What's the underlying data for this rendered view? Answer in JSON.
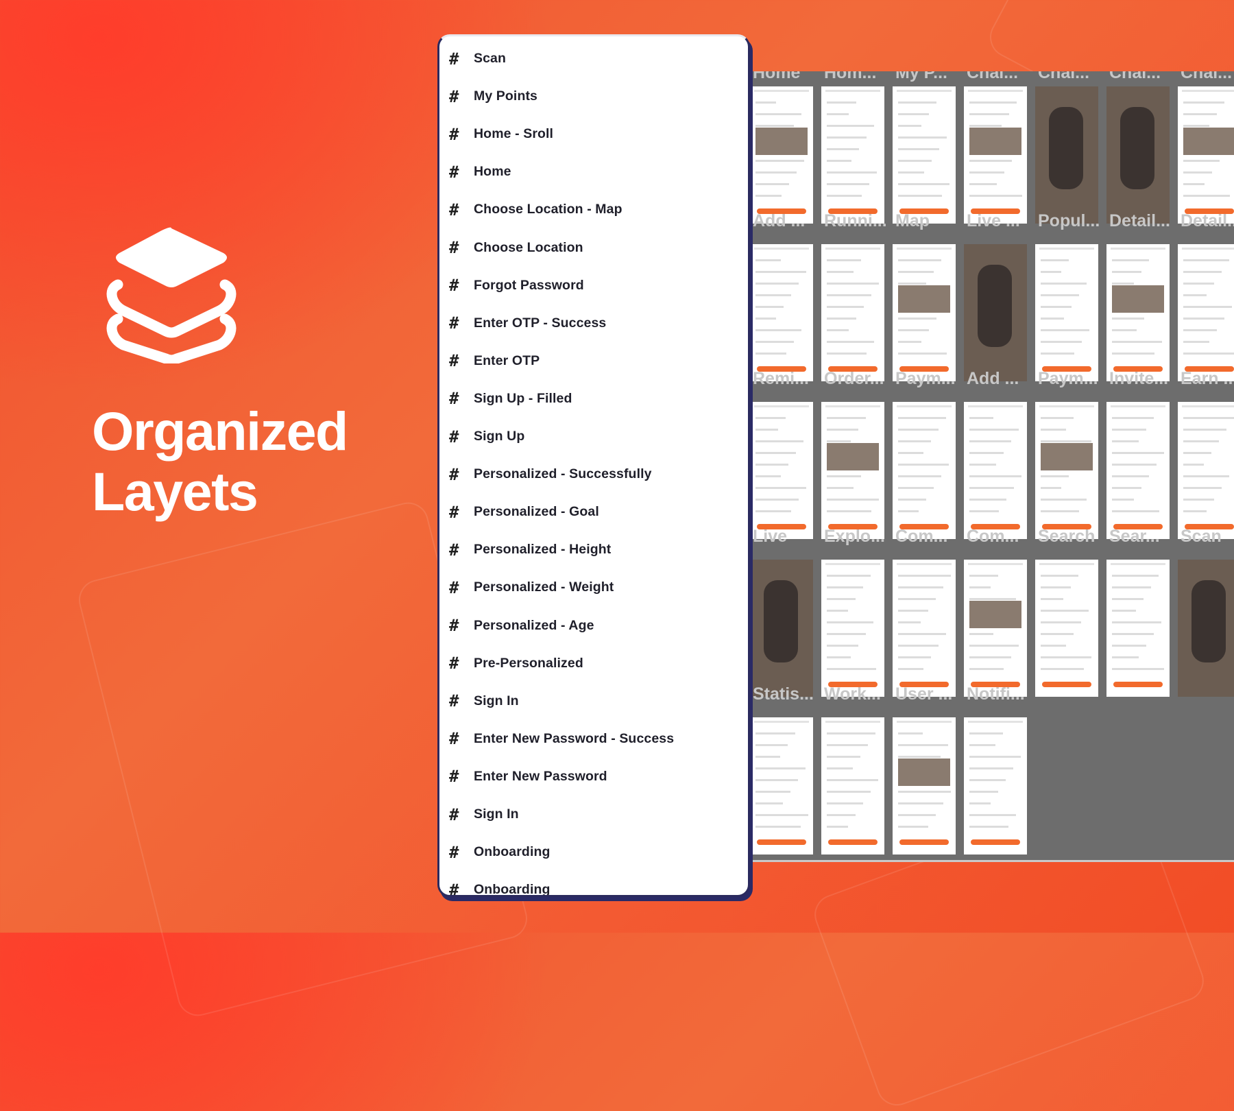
{
  "hero": {
    "icon": "layers-stack-icon",
    "title_line1": "Organized",
    "title_line2": "Layets"
  },
  "layers": {
    "icon": "frame-hash-icon",
    "items": [
      "Scan",
      "My Points",
      "Home - Sroll",
      "Home",
      "Choose Location - Map",
      "Choose Location",
      "Forgot Password",
      "Enter OTP - Success",
      "Enter OTP",
      "Sign Up - Filled",
      "Sign Up",
      "Personalized - Successfully",
      "Personalized - Goal",
      "Personalized - Height",
      "Personalized - Weight",
      "Personalized - Age",
      "Pre-Personalized",
      "Sign In",
      "Enter New Password - Success",
      "Enter New Password",
      "Sign In",
      "Onboarding",
      "Onboarding"
    ]
  },
  "canvas": {
    "rows": [
      {
        "top_labels": [
          "Home",
          "Hom...",
          "My P...",
          "Chal...",
          "Chal...",
          "Chal...",
          "Chal..."
        ],
        "bottom_labels": [
          "Add ...",
          "Runni...",
          "Map",
          "Live ...",
          "Popul...",
          "Detail...",
          "Detail..."
        ]
      },
      {
        "top_labels": [],
        "bottom_labels": [
          "Remi...",
          "Order...",
          "Paym...",
          "Add ...",
          "Paym...",
          "Invite...",
          "Earn ..."
        ]
      },
      {
        "top_labels": [],
        "bottom_labels": [
          "Live",
          "Explo...",
          "Com...",
          "Com...",
          "Search",
          "Sear...",
          "Scan"
        ]
      },
      {
        "top_labels": [],
        "bottom_labels": [
          "Statis...",
          "Work...",
          "User ...",
          "Notifi...",
          "",
          "",
          ""
        ]
      }
    ]
  },
  "colors": {
    "accent": "#f26a2c",
    "panel_border": "#2b2a5e",
    "canvas_bg": "#6d6d6d"
  }
}
